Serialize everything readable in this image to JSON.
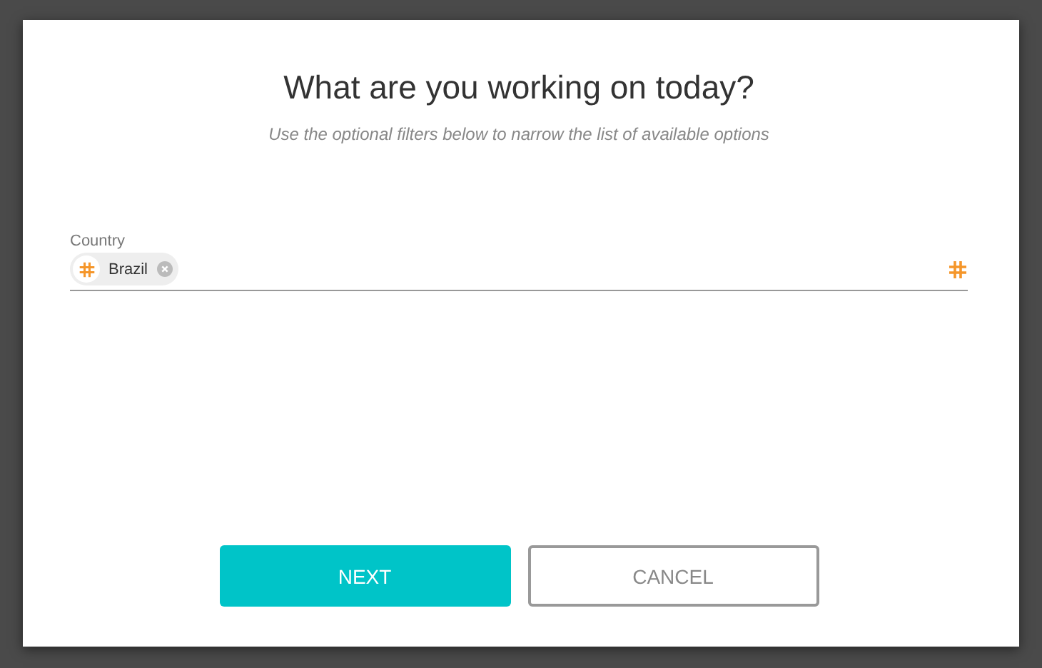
{
  "dialog": {
    "title": "What are you working on today?",
    "subtitle": "Use the optional filters below to narrow the list of available options",
    "field": {
      "label": "Country",
      "chips": [
        {
          "label": "Brazil"
        }
      ]
    },
    "buttons": [
      {
        "label": "NEXT",
        "kind": "primary"
      },
      {
        "label": "CANCEL",
        "kind": "secondary"
      }
    ]
  }
}
